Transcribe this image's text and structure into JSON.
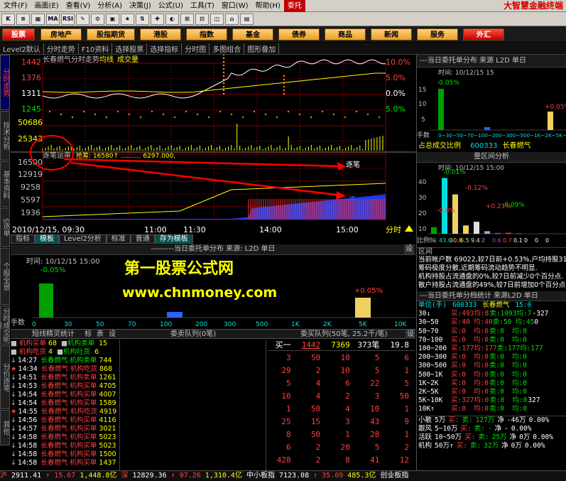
{
  "menu": {
    "items": [
      "文件(F)",
      "画面(E)",
      "查看(V)",
      "分析(A)",
      "决策(J)",
      "公式(U)",
      "工具(T)",
      "窗口(W)",
      "帮助(H)",
      "委托"
    ],
    "brand": "大智慧金融终端"
  },
  "toolbar": {
    "icons": [
      "K",
      "≡",
      "▦",
      "MA",
      "RSI",
      "✎",
      "⚙",
      "▣",
      "★",
      "⇅",
      "✚",
      "◐",
      "⊞",
      "⊡",
      "◫",
      "⌂",
      "▤"
    ]
  },
  "categories": [
    "股票",
    "房地产",
    "股指期货",
    "港股",
    "指数",
    "基金",
    "债券",
    "商品",
    "新闻",
    "服务",
    "外汇"
  ],
  "subbar": [
    "Level2默认",
    "分时走势",
    "F10资料",
    "选择股票",
    "选择指标",
    "分时图",
    "多图组合",
    "图形叠加"
  ],
  "vtabs": [
    "分时走势",
    "技术分析",
    "基本资料",
    "S逐单",
    "个股全景",
    "分时成交明细",
    "分价逐笔",
    "其他"
  ],
  "chart": {
    "title": "长春燃气分时走势",
    "legend_avg": "均线",
    "legend_vol": "成交量",
    "price_labels": [
      "1442",
      "1376",
      "1311",
      "1245"
    ],
    "pct_labels": [
      "10.0%",
      "5.0%",
      "0.0%",
      "5.0%"
    ],
    "vol_labels": [
      "50686",
      "25343"
    ],
    "tick_title": "逐笔运串",
    "tick_values": "抢筹: 16580↑  ..........  6297.000,",
    "tick_labels": [
      "16500",
      "12919",
      "9258",
      "5597",
      "1936"
    ],
    "tick_annot": "逐笔",
    "tick_annot2": "逐",
    "date": "2010/12/15, 09:30",
    "times": [
      "11:00",
      "11:30",
      "14:00",
      "15:00"
    ],
    "timeframe": "分时",
    "colors": {
      "price": "#ffffff",
      "avg": "#ffff00",
      "grid": "#800000",
      "red": "#ff3030",
      "blue": "#2040ff"
    }
  },
  "bottom_tabs": [
    "指标",
    "模板",
    "Level2分析",
    "标准",
    "普通",
    "存为模板"
  ],
  "dist_panel": {
    "title": "---------当日委托单分布  来源: L2D  单日",
    "setting": "设",
    "time_label": "时间: 10/12/15 15:00",
    "pct": "-0.05%",
    "pct2": "+0.05%",
    "xlabels": [
      "0",
      "30",
      "50",
      "70",
      "100",
      "200",
      "300",
      "500",
      "1K",
      "2K",
      "5K",
      "10K"
    ],
    "row_label": "手数"
  },
  "watermark": {
    "line1": "第一股票公式网",
    "line2": "www.chnmoney.com"
  },
  "lower_tabs": [
    "短线精灵统计",
    "标",
    "表",
    "设",
    "委卖队列(0笔)",
    "委买队列(50笔, 25.2千/笔)",
    "设"
  ],
  "sprites": [
    {
      "time": "",
      "name": "机构买单",
      "n": "68",
      "color": "red"
    },
    {
      "time": "",
      "name": "机构吃货",
      "n": "4",
      "color": "red"
    },
    {
      "time": "14:27",
      "name": "长春燃气 机构卖单",
      "n": "744",
      "color": "green"
    },
    {
      "time": "14:34",
      "name": "长春燃气 机构吃货",
      "n": "868",
      "color": "red"
    },
    {
      "time": "14:51",
      "name": "长春燃气 机构卖单",
      "n": "1261",
      "color": "red"
    },
    {
      "time": "14:53",
      "name": "长春燃气 机构买单",
      "n": "4705",
      "color": "red"
    },
    {
      "time": "14:54",
      "name": "长春燃气 机构买单",
      "n": "4007",
      "color": "red"
    },
    {
      "time": "14:54",
      "name": "长春燃气 机构买单",
      "n": "1589",
      "color": "red"
    },
    {
      "time": "14:55",
      "name": "长春燃气 机构吃货",
      "n": "4919",
      "color": "red"
    },
    {
      "time": "14:56",
      "name": "长春燃气 机构买单",
      "n": "4116",
      "color": "red"
    },
    {
      "time": "14:57",
      "name": "长春燃气 机构买单",
      "n": "3021",
      "color": "red"
    },
    {
      "time": "14:58",
      "name": "长春燃气 机构买单",
      "n": "5023",
      "color": "red"
    },
    {
      "time": "14:58",
      "name": "长春燃气 机构买单",
      "n": "5023",
      "color": "red"
    },
    {
      "time": "14:58",
      "name": "长春燃气 机构买单",
      "n": "1500",
      "color": "red"
    },
    {
      "time": "14:58",
      "name": "长春燃气 机构买单",
      "n": "1437",
      "color": "red"
    }
  ],
  "sprite_right": [
    {
      "name": "机构卖单",
      "n": "15"
    },
    {
      "name": "机构吐货",
      "n": "6"
    }
  ],
  "queue": {
    "header": [
      "买一",
      "1442",
      "7369",
      "373笔",
      "19.8"
    ],
    "rows": [
      [
        "3",
        "50",
        "10",
        "5",
        "6"
      ],
      [
        "29",
        "2",
        "10",
        "5",
        "1"
      ],
      [
        "5",
        "4",
        "6",
        "22",
        "5"
      ],
      [
        "10",
        "4",
        "2",
        "3",
        "50"
      ],
      [
        "1",
        "50",
        "4",
        "10",
        "1"
      ],
      [
        "25",
        "15",
        "3",
        "43",
        "9"
      ],
      [
        "8",
        "50",
        "1",
        "28",
        "1"
      ],
      [
        "6",
        "2",
        "20",
        "5",
        "2"
      ],
      [
        "428",
        "2",
        "8",
        "41",
        "12"
      ]
    ]
  },
  "right": {
    "panel1_title": "---当日委托单分布  来源 L2D  单日",
    "panel1_time": "时间: 10/12/15 15",
    "panel1_pct": "-0.05%",
    "panel1_pct2": "+0.05%",
    "panel1_scale": [
      "15",
      "10",
      "5"
    ],
    "panel1_xl": "0~30~50~70~100~200~300~500~1K~2K~5K~10K",
    "panel1_rowlbl": "手数",
    "bar_title_prefix": "占总成交比例",
    "bar_code": "600333",
    "bar_name": "长春燃气",
    "panel2_title": "量区间分析",
    "panel2_time": "时间: 10/12/15 15:00",
    "panel2_scale": [
      "40",
      "30",
      "20",
      "10"
    ],
    "panel2_pcts": [
      "-0.01%",
      "-0.12%",
      "+0.21%",
      "-0.09%",
      "-0.0%"
    ],
    "panel2_row": "比例%",
    "panel2_vals": [
      "5.1",
      "43.6",
      "30.8",
      "6.5",
      "9.4",
      "2",
      "0.6",
      "0.7",
      "0.1",
      "0",
      "0",
      "0"
    ],
    "info_title": "区间",
    "info_lines": [
      "当前帐户数 69022,较7日前+0.53%,户均持股3140.",
      "筹码极度分散,近期筹码流动趋势不明显.",
      "机构持股占流通盘的0%,较7日前减少0个百分点.",
      "散户持股占流通盘的49%,较7日前增加0个百分点."
    ],
    "panel3_title": "---当日委托单分档统计  来源L2D  单日",
    "p3_header": [
      "单位(手)",
      "600333",
      "长春燃气",
      "15:0"
    ],
    "p3_rows": [
      [
        "30↓",
        "买:493",
        "均:8",
        "卖:1093",
        "均:7",
        "-327"
      ],
      [
        "30~50",
        "买:40",
        "均:40",
        "卖:50",
        "均:45",
        "0"
      ],
      [
        "50~70",
        "买:0",
        "均:0",
        "卖:0",
        "均:0",
        ""
      ],
      [
        "70~100",
        "买:0",
        "均:0",
        "卖:0",
        "均:0",
        ""
      ],
      [
        "100~200",
        "买:177",
        "均:177",
        "卖:177",
        "均:177",
        ""
      ],
      [
        "200~300",
        "买:0",
        "均:0",
        "卖:0",
        "均:0",
        ""
      ],
      [
        "300~500",
        "买:0",
        "均:0",
        "卖:0",
        "均:0",
        ""
      ],
      [
        "500~1K",
        "买:0",
        "均:0",
        "卖:0",
        "均:0",
        ""
      ],
      [
        "1K~2K",
        "买:0",
        "均:0",
        "卖:0",
        "均:0",
        ""
      ],
      [
        "2K~5K",
        "买:0",
        "均:0",
        "卖:0",
        "均:0",
        ""
      ],
      [
        "5K~10K",
        "买:327",
        "均:0",
        "卖:0",
        "均:0",
        "327"
      ],
      [
        "10K↑",
        "买:0",
        "均:0",
        "卖:0",
        "均:0",
        ""
      ]
    ],
    "p3_summary": [
      [
        "小散",
        "5万",
        "买:",
        "卖:",
        "127万",
        "净",
        "-46万",
        "0.00%"
      ],
      [
        "跟风",
        "5~10万",
        "买:",
        "卖:",
        "-",
        "净",
        "-",
        "0.00%"
      ],
      [
        "活跃",
        "10~50万",
        "买:",
        "卖:",
        "25万",
        "净",
        "0万",
        "0.00%"
      ],
      [
        "机构",
        "50万↑",
        "买:",
        "卖:",
        "32万",
        "净",
        "0万",
        "0.00%"
      ]
    ]
  },
  "status": [
    {
      "t": "沪",
      "c": "red"
    },
    {
      "t": "2911.41",
      "c": "white"
    },
    {
      "t": "↑ 15.67",
      "c": "red"
    },
    {
      "t": "1,448.8亿",
      "c": "yellow"
    },
    {
      "t": "深",
      "c": "red"
    },
    {
      "t": "12829.36",
      "c": "white"
    },
    {
      "t": "↑ 97.26",
      "c": "red"
    },
    {
      "t": "1,310.4亿",
      "c": "yellow"
    },
    {
      "t": "中小板指",
      "c": "white"
    },
    {
      "t": "7123.08",
      "c": "white"
    },
    {
      "t": "↑ 35.09",
      "c": "red"
    },
    {
      "t": "485.3亿",
      "c": "yellow"
    },
    {
      "t": "创业板指",
      "c": "white"
    }
  ]
}
